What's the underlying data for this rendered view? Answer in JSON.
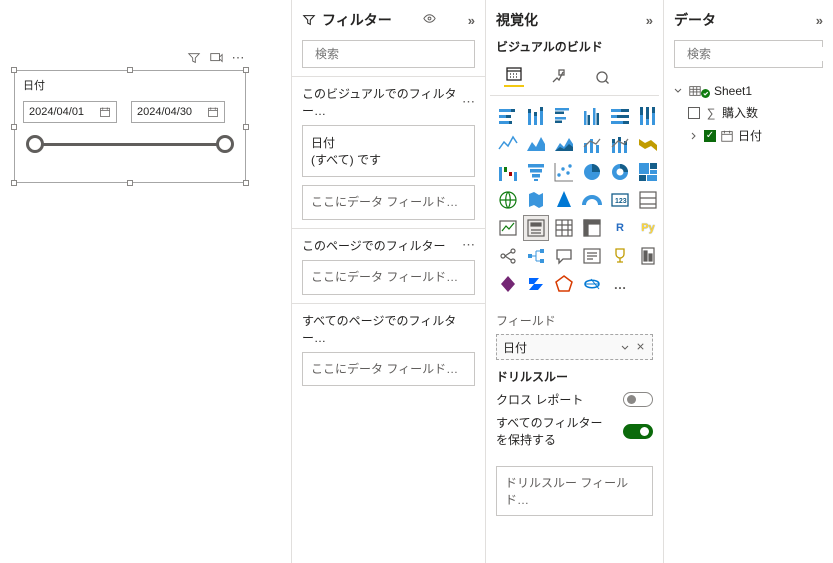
{
  "slicer": {
    "title": "日付",
    "date_from": "2024/04/01",
    "date_to": "2024/04/30"
  },
  "filter_pane": {
    "title": "フィルター",
    "search_placeholder": "検索",
    "visual_filters_label": "このビジュアルでのフィルター…",
    "card_field": "日付",
    "card_state": "(すべて) です",
    "drop_text": "ここにデータ フィールド…",
    "page_filters_label": "このページでのフィルター",
    "all_pages_filters_label": "すべてのページでのフィルター…"
  },
  "viz_pane": {
    "title": "視覚化",
    "subtitle": "ビジュアルのビルド",
    "fields_label": "フィールド",
    "field_name": "日付",
    "drill_title": "ドリルスルー",
    "cross_report": "クロス レポート",
    "keep_all_filters": "すべてのフィルターを保持する",
    "drill_drop": "ドリルスルー フィールド…",
    "r_label": "R",
    "py_label": "Py",
    "more": "…"
  },
  "data_pane": {
    "title": "データ",
    "search_placeholder": "検索",
    "table": "Sheet1",
    "field_qty": "購入数",
    "field_date": "日付"
  }
}
